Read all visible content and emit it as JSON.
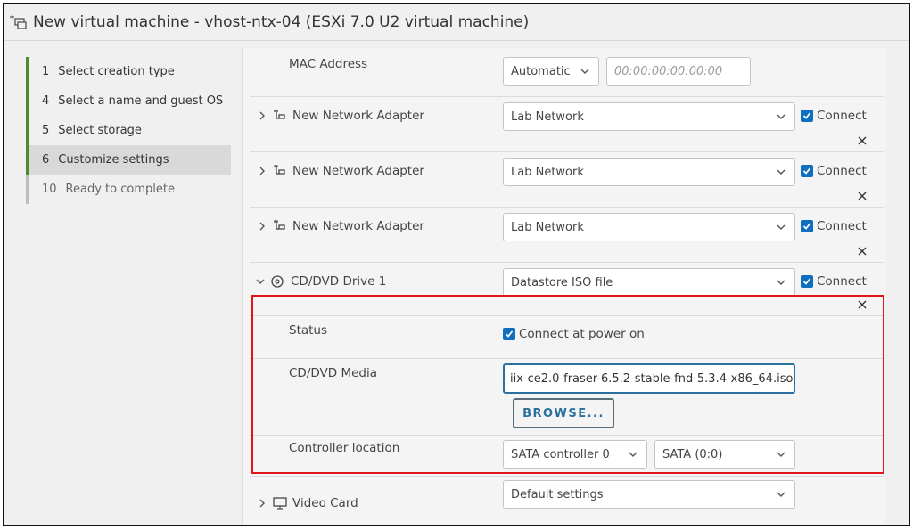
{
  "window": {
    "title": "New virtual machine - vhost-ntx-04 (ESXi 7.0 U2 virtual machine)",
    "icon": "new-vm-icon"
  },
  "steps": [
    {
      "num": "1",
      "label": "Select creation type",
      "state": "done"
    },
    {
      "num": "4",
      "label": "Select a name and guest OS",
      "state": "done"
    },
    {
      "num": "5",
      "label": "Select storage",
      "state": "done"
    },
    {
      "num": "6",
      "label": "Customize settings",
      "state": "active"
    },
    {
      "num": "10",
      "label": "Ready to complete",
      "state": "pending"
    }
  ],
  "mac": {
    "label": "MAC Address",
    "mode": "Automatic",
    "placeholder": "00:00:00:00:00:00"
  },
  "adapters": [
    {
      "label": "New Network Adapter",
      "network": "Lab Network",
      "connect": "Connect",
      "connected": true
    },
    {
      "label": "New Network Adapter",
      "network": "Lab Network",
      "connect": "Connect",
      "connected": true
    },
    {
      "label": "New Network Adapter",
      "network": "Lab Network",
      "connect": "Connect",
      "connected": true
    }
  ],
  "cdrom": {
    "label": "CD/DVD Drive 1",
    "type": "Datastore ISO file",
    "connect": "Connect",
    "connected": true,
    "status_label": "Status",
    "status_value": "Connect at power on",
    "media_label": "CD/DVD Media",
    "media_value": "iix-ce2.0-fraser-6.5.2-stable-fnd-5.3.4-x86_64.iso",
    "browse": "BROWSE...",
    "controller_label": "Controller location",
    "controller": "SATA controller 0",
    "slot": "SATA (0:0)"
  },
  "video": {
    "label": "Video Card",
    "value": "Default settings"
  },
  "colors": {
    "accent": "#0f6fbf",
    "step_done": "#4d8c2e",
    "highlight": "#e0161b"
  }
}
